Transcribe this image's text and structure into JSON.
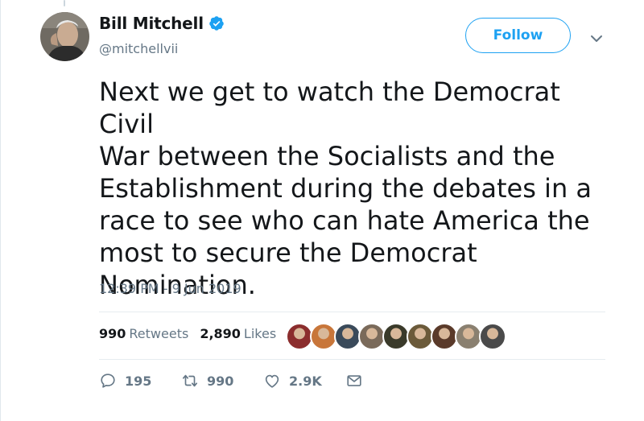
{
  "author": {
    "name": "Bill Mitchell",
    "handle": "@mitchellvii",
    "verified": true
  },
  "follow_label": "Follow",
  "tweet": {
    "text": "Next we get to watch the Democrat Civil\nWar between the Socialists and the\nEstablishment during the debates in a\nrace to see who can hate America the\nmost to secure the Democrat\nNomination.",
    "timestamp": "12:39 PM - 9 Jun 2019"
  },
  "stats": {
    "retweets_count": "990",
    "retweets_label": "Retweets",
    "likes_count": "2,890",
    "likes_label": "Likes"
  },
  "likers": [
    {
      "color": "#8b2d2d"
    },
    {
      "color": "#c8763a"
    },
    {
      "color": "#3a4a5a"
    },
    {
      "color": "#7a6a5a"
    },
    {
      "color": "#3a3a2a"
    },
    {
      "color": "#6b5a3a"
    },
    {
      "color": "#5a3a2a"
    },
    {
      "color": "#8a8070"
    },
    {
      "color": "#4a4a4a"
    }
  ],
  "actions": {
    "replies": "195",
    "retweets": "990",
    "likes": "2.9K"
  },
  "colors": {
    "accent": "#1da1f2",
    "text": "#14171a",
    "secondary": "#657786"
  }
}
